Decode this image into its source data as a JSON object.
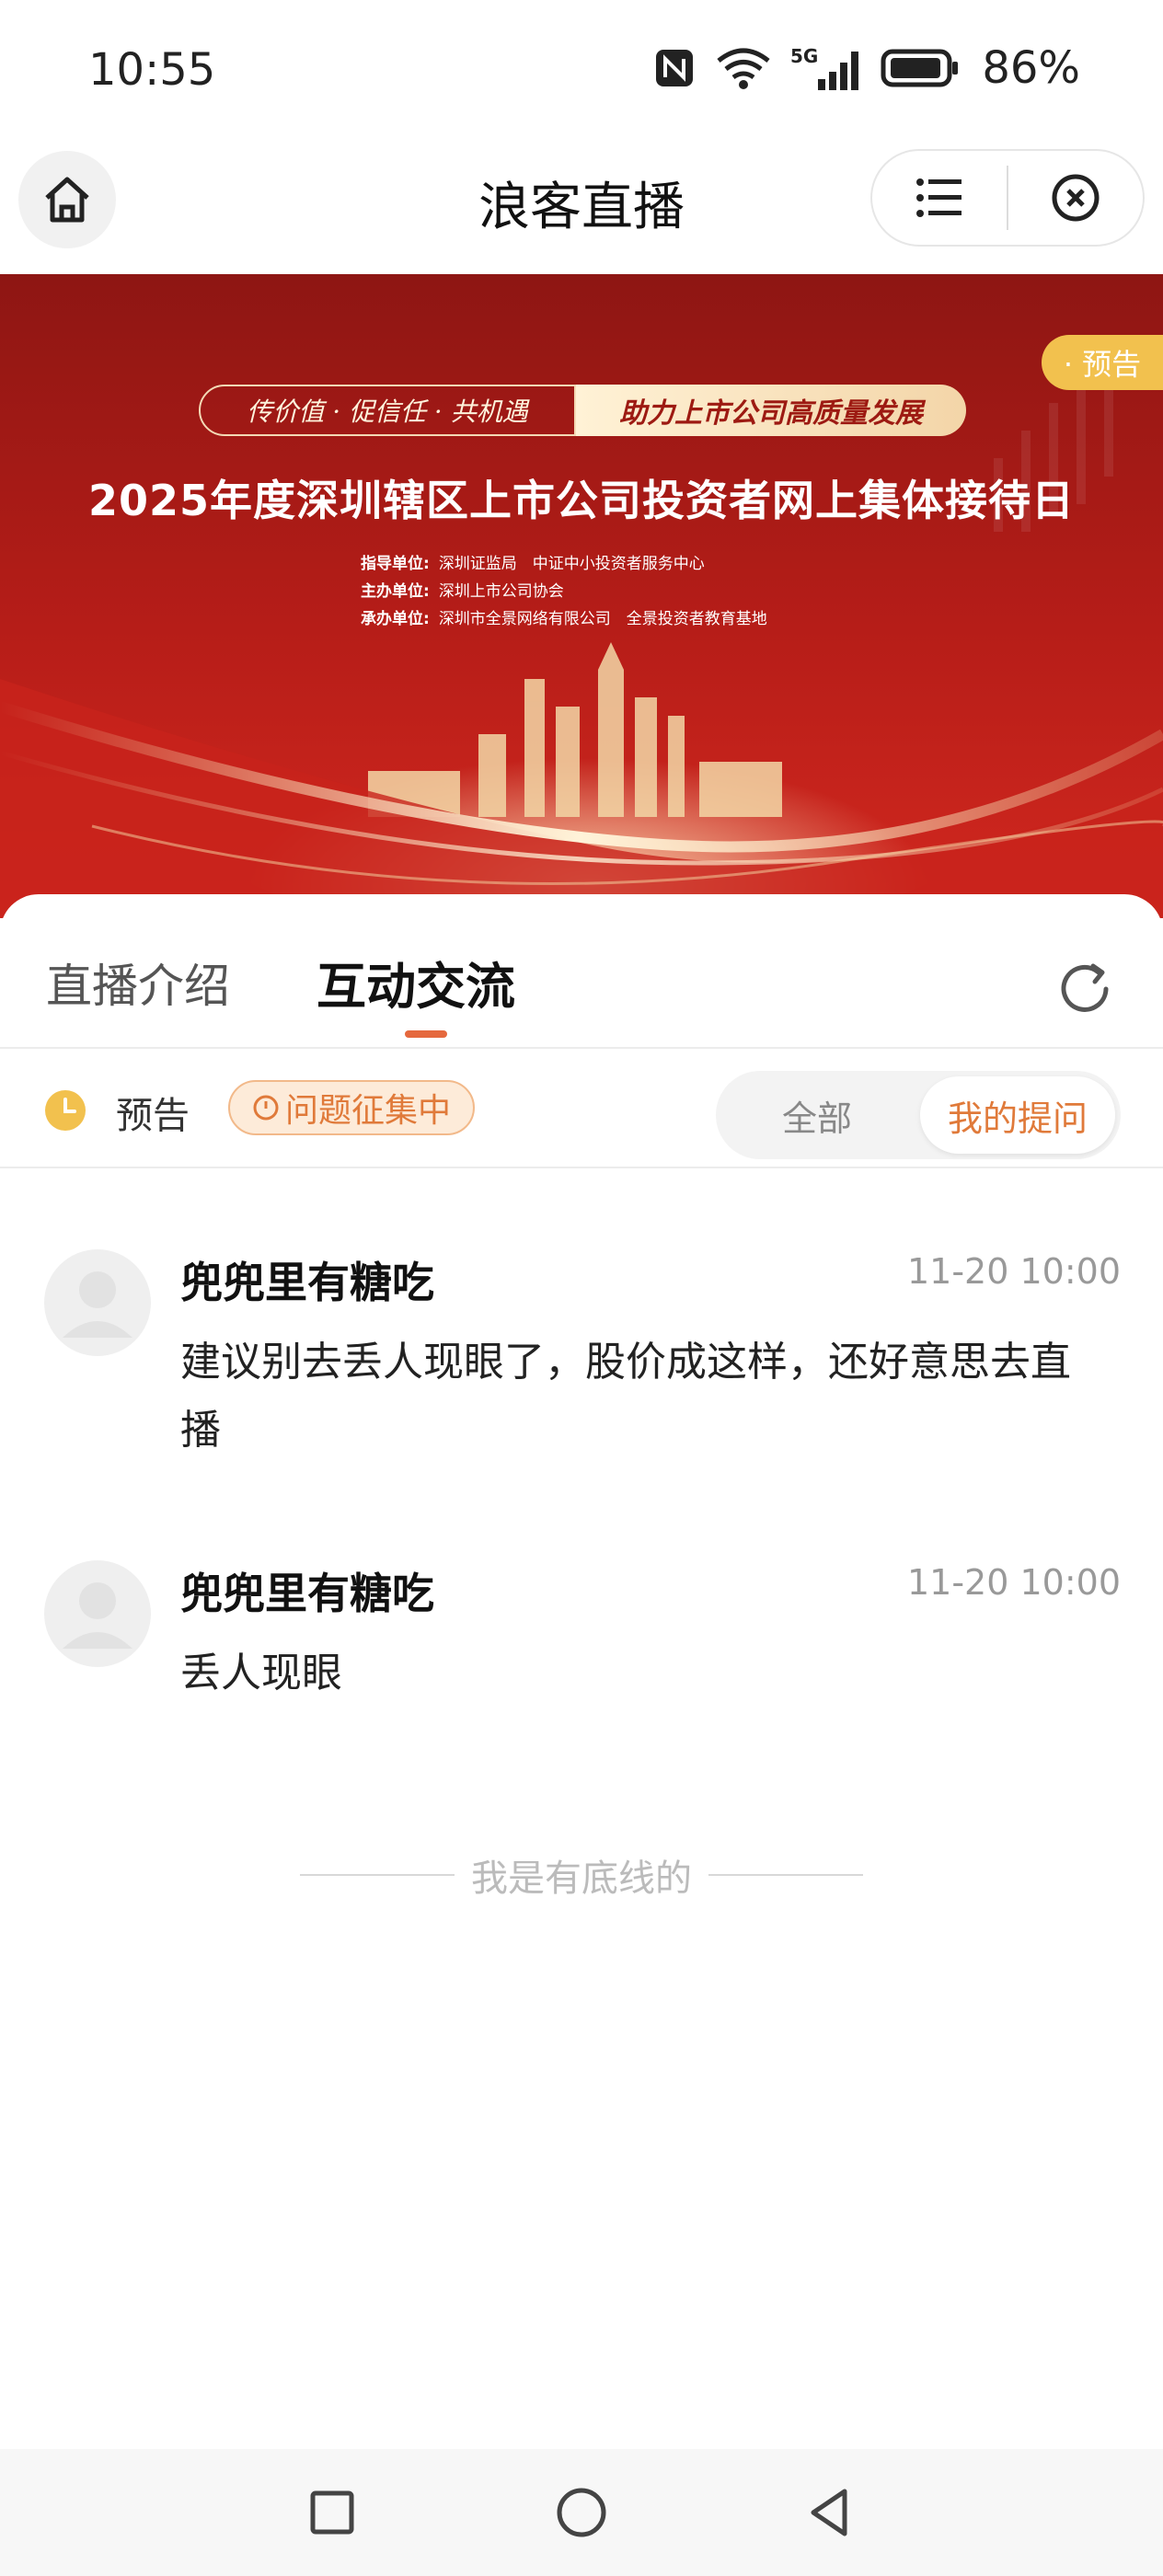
{
  "status_bar": {
    "time": "10:55",
    "battery": "86%",
    "icons": [
      "nfc-icon",
      "wifi-icon",
      "signal-5g-icon",
      "battery-icon"
    ]
  },
  "header": {
    "title": "浪客直播",
    "icons": [
      "home-icon",
      "menu-list-icon",
      "close-circle-icon"
    ]
  },
  "banner": {
    "slogan_left": "传价值 · 促信任 · 共机遇",
    "slogan_right": "助力上市公司高质量发展",
    "title": "2025年度深圳辖区上市公司投资者网上集体接待日",
    "orgs": [
      {
        "key": "指导单位:",
        "value": "深圳证监局　中证中小投资者服务中心"
      },
      {
        "key": "主办单位:",
        "value": "深圳上市公司协会"
      },
      {
        "key": "承办单位:",
        "value": "深圳市全景网络有限公司　全景投资者教育基地"
      }
    ],
    "badge": "· 预告",
    "colors": {
      "bg_dark": "#8e1613",
      "bg_mid": "#c8231c",
      "gold": "#f6d9a6"
    }
  },
  "tabs": {
    "intro": "直播介绍",
    "chat": "互动交流"
  },
  "filter": {
    "status": "预告",
    "collect": "问题征集中",
    "segment_all": "全部",
    "segment_mine": "我的提问"
  },
  "comments": [
    {
      "user": "兜兜里有糖吃",
      "time": "11-20 10:00",
      "text": "建议别去丢人现眼了，股价成这样，还好意思去直播"
    },
    {
      "user": "兜兜里有糖吃",
      "time": "11-20 10:00",
      "text": "丢人现眼"
    }
  ],
  "bottom_line": "我是有底线的",
  "nav": [
    "recent-apps-icon",
    "home-circle-icon",
    "back-triangle-icon"
  ],
  "accent_color": "#e07a3a"
}
